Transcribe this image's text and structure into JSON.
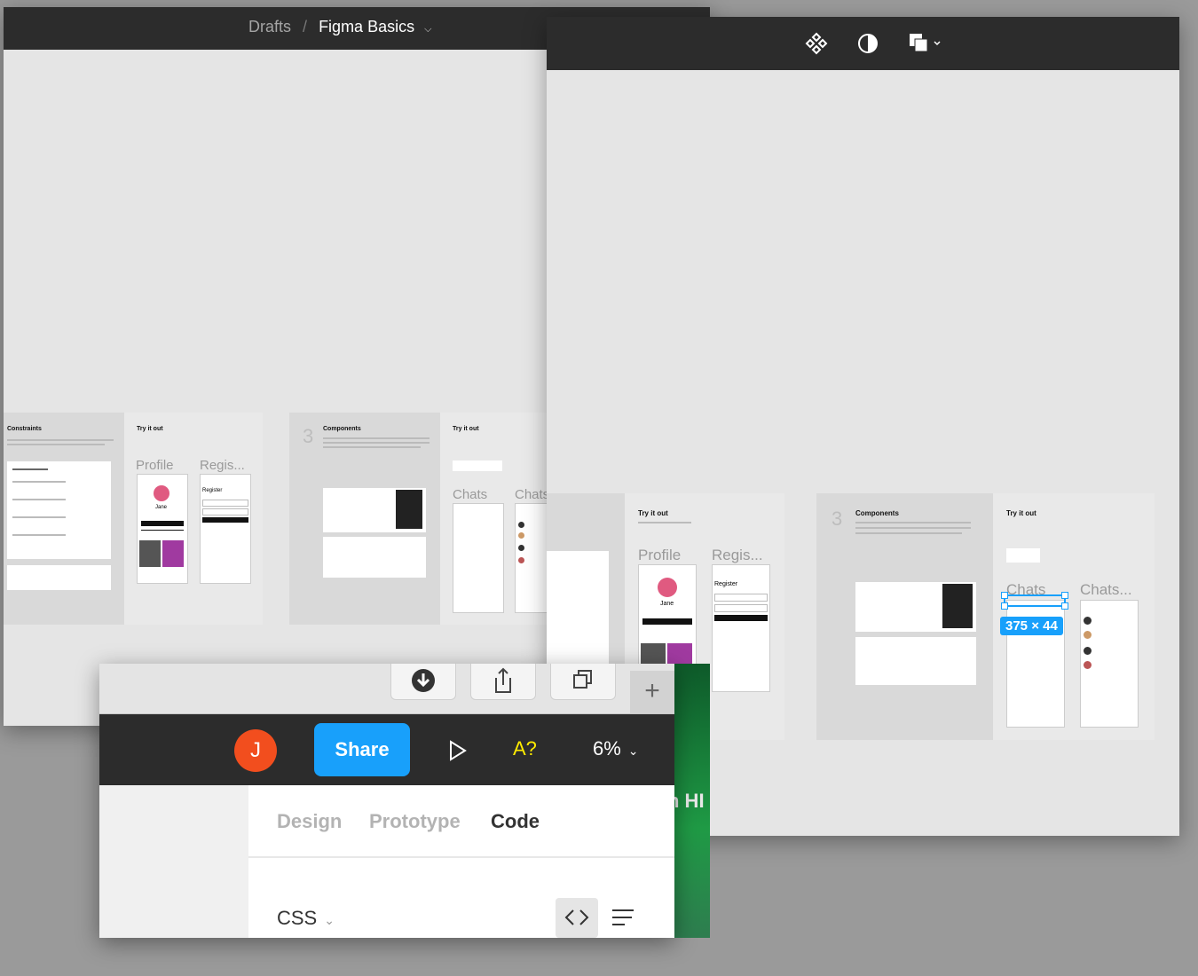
{
  "breadcrumb": {
    "parent": "Drafts",
    "separator": "/",
    "file": "Figma Basics"
  },
  "canvas_left": {
    "constraints_title": "Constraints",
    "try_title_1": "Try it out",
    "profile_label": "Profile",
    "register_label": "Regis...",
    "jane_name": "Jane",
    "register_heading": "Register",
    "section_number": "3",
    "components_title": "Components",
    "try_title_2": "Try it out",
    "chats_label_1": "Chats",
    "chats_label_2": "Chats"
  },
  "canvas_right": {
    "try_title_1": "Try it out",
    "profile_label": "Profile",
    "register_label": "Regis...",
    "jane_name": "Jane",
    "register_heading": "Register",
    "section_number": "3",
    "components_title": "Components",
    "try_title_2": "Try it out",
    "chats_label_1": "Chats",
    "chats_label_2": "Chats...",
    "selection_size": "375 × 44"
  },
  "toolbar_icons": [
    "component-icon",
    "contrast-icon",
    "boolean-icon"
  ],
  "app": {
    "user_initial": "J",
    "share_label": "Share",
    "a11y_label": "A?",
    "zoom_label": "6%",
    "tabs": [
      "Design",
      "Prototype",
      "Code"
    ],
    "active_tab": "Code",
    "code_language": "CSS",
    "background_text": "h HI"
  },
  "colors": {
    "accent": "#18a0fb",
    "avatar": "#f24e1e",
    "toolbar": "#2c2c2c",
    "warning": "#ffeb00"
  }
}
